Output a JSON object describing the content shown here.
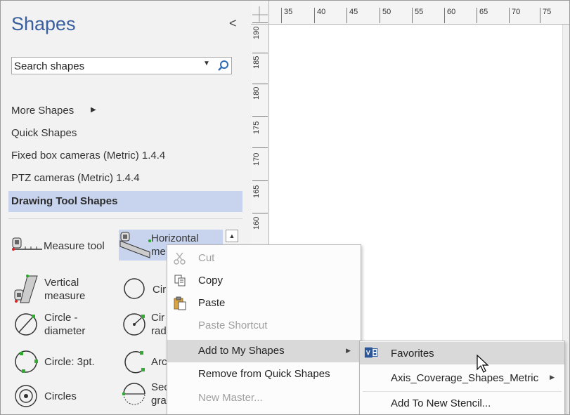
{
  "pane": {
    "title": "Shapes",
    "collapse_glyph": "<",
    "search_placeholder": "Search shapes",
    "search_value": "Search shapes",
    "nav": {
      "more_shapes": "More Shapes",
      "quick_shapes": "Quick Shapes",
      "fixed_box": "Fixed box cameras (Metric) 1.4.4",
      "ptz": "PTZ cameras (Metric) 1.4.4",
      "drawing_tool": "Drawing Tool Shapes"
    },
    "stencil": {
      "measure_tool": "Measure tool",
      "horizontal_line1": "Horizontal",
      "horizontal_line2": "me",
      "vertical_line1": "Vertical",
      "vertical_line2": "measure",
      "circle_cut": "Cir",
      "circle_diameter_line1": "Circle -",
      "circle_diameter_line2": "diameter",
      "circle_radius_line1": "Cir",
      "circle_radius_line2": "rad",
      "circle_3pt": "Circle: 3pt.",
      "arc_cut": "Arc",
      "circles": "Circles",
      "sector_line1": "Sec",
      "sector_line2": "gra"
    }
  },
  "ruler": {
    "horizontal": [
      "35",
      "40",
      "45",
      "50",
      "55",
      "60",
      "65",
      "70",
      "75"
    ],
    "vertical": [
      "190",
      "185",
      "180",
      "175",
      "170",
      "165",
      "160"
    ]
  },
  "context_menu": {
    "cut": "Cut",
    "copy": "Copy",
    "paste": "Paste",
    "paste_shortcut": "Paste Shortcut",
    "add_to_my_shapes": "Add to My Shapes",
    "remove_from_quick": "Remove from Quick Shapes",
    "new_master": "New Master..."
  },
  "submenu": {
    "favorites": "Favorites",
    "axis_coverage": "Axis_Coverage_Shapes_Metric",
    "add_new_stencil": "Add To New Stencil..."
  },
  "colors": {
    "title_blue": "#3a5f9f",
    "selected_bg": "#c8d4ee",
    "menu_hover": "#d9d9d9",
    "disabled_text": "#a0a0a0"
  }
}
